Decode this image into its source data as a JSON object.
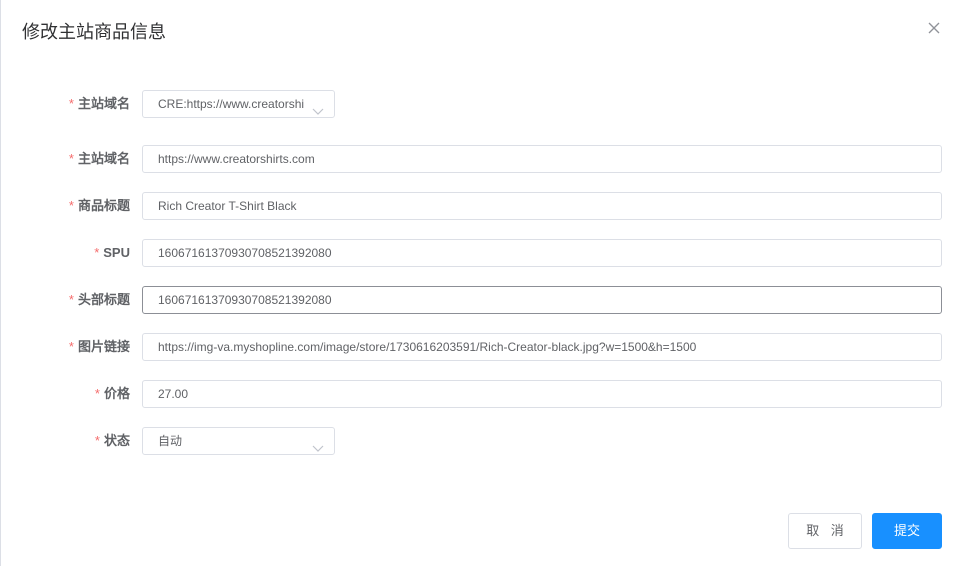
{
  "dialog": {
    "title": "修改主站商品信息"
  },
  "form": {
    "required_mark": "*",
    "fields": [
      {
        "label": "主站域名",
        "type": "select",
        "value": "CRE:https://www.creatorshi"
      },
      {
        "label": "主站域名",
        "type": "input",
        "value": "https://www.creatorshirts.com"
      },
      {
        "label": "商品标题",
        "type": "input",
        "value": "Rich Creator T-Shirt Black"
      },
      {
        "label": "SPU",
        "type": "input",
        "value": "1606716137093070852139208​0"
      },
      {
        "label": "头部标题",
        "type": "input",
        "value": "16067161370930708521392080"
      },
      {
        "label": "图片链接",
        "type": "input",
        "value": "https://img-va.myshopline.com/image/store/1730616203591/Rich-Creator-black.jpg?w=1500&h=1500"
      },
      {
        "label": "价格",
        "type": "input",
        "value": "27.00"
      },
      {
        "label": "状态",
        "type": "select",
        "value": "自动"
      }
    ]
  },
  "footer": {
    "cancel_label": "取 消",
    "submit_label": "提交"
  },
  "icons": {
    "close": "close-icon",
    "select_arrow": "chevron-down-icon"
  },
  "colors": {
    "primary": "#1890ff",
    "required": "#f56c6c",
    "border": "#dcdfe6"
  }
}
